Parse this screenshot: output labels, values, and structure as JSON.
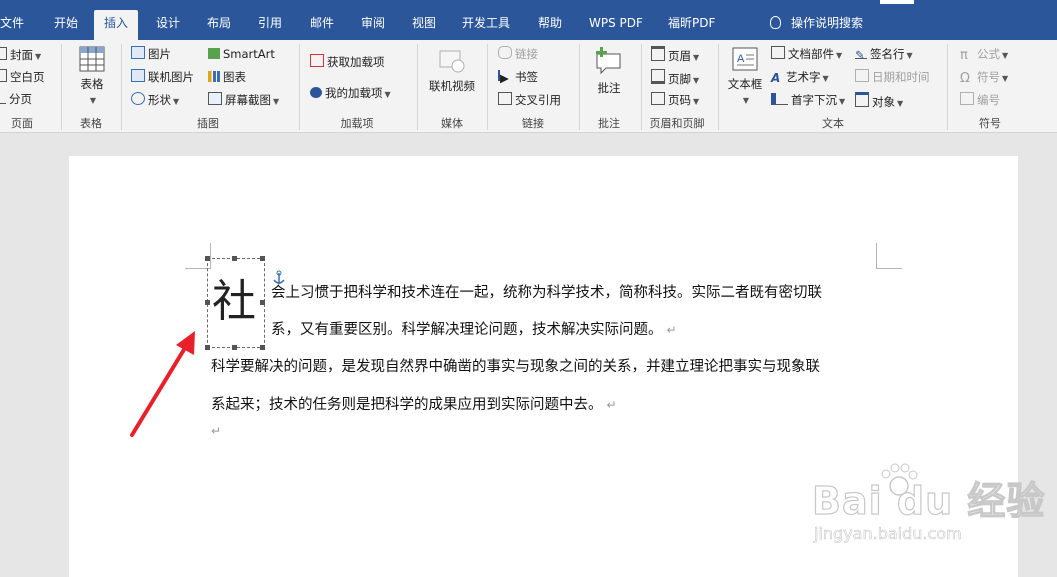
{
  "tabs": [
    "文件",
    "开始",
    "插入",
    "设计",
    "布局",
    "引用",
    "邮件",
    "审阅",
    "视图",
    "开发工具",
    "帮助",
    "WPS PDF",
    "福昕PDF"
  ],
  "active_tab": "插入",
  "tell_me": "操作说明搜索",
  "ribbon": {
    "pages": {
      "cover": "封面",
      "blank": "空白页",
      "break": "分页",
      "label": "页面"
    },
    "tables": {
      "table": "表格",
      "label": "表格"
    },
    "illustrations": {
      "picture": "图片",
      "online_picture": "联机图片",
      "shapes": "形状",
      "smartart": "SmartArt",
      "chart": "图表",
      "screenshot": "屏幕截图",
      "label": "插图"
    },
    "addins": {
      "get": "获取加载项",
      "my": "我的加载项",
      "label": "加载项"
    },
    "media": {
      "online_video": "联机视频",
      "label": "媒体"
    },
    "links": {
      "link": "链接",
      "bookmark": "书签",
      "cross_ref": "交叉引用",
      "label": "链接"
    },
    "comments": {
      "comment": "批注",
      "label": "批注"
    },
    "header_footer": {
      "header": "页眉",
      "footer": "页脚",
      "page_number": "页码",
      "label": "页眉和页脚"
    },
    "text": {
      "textbox": "文本框",
      "quick_parts": "文档部件",
      "wordart": "艺术字",
      "dropcap": "首字下沉",
      "signature": "签名行",
      "datetime": "日期和时间",
      "object": "对象",
      "label": "文本"
    },
    "symbols": {
      "equation": "公式",
      "symbol": "符号",
      "number": "编号",
      "label": "符号"
    }
  },
  "document": {
    "drop_cap": "社",
    "line1": "会上习惯于把科学和技术连在一起，统称为科学技术，简称科技。实际二者既有密切联",
    "line2": "系，又有重要区别。科学解决理论问题，技术解决实际问题。",
    "line3": "科学要解决的问题，是发现自然界中确凿的事实与现象之间的关系，并建立理论把事实与现象联",
    "line4": "系起来；技术的任务则是把科学的成果应用到实际问题中去。",
    "para_mark": "↵"
  },
  "watermark": {
    "brand": "Bai du 经验",
    "url": "jingyan.baidu.com"
  },
  "colors": {
    "title_bar": "#2b579a",
    "ribbon": "#f3f3f3",
    "arrow": "#e8202a"
  }
}
